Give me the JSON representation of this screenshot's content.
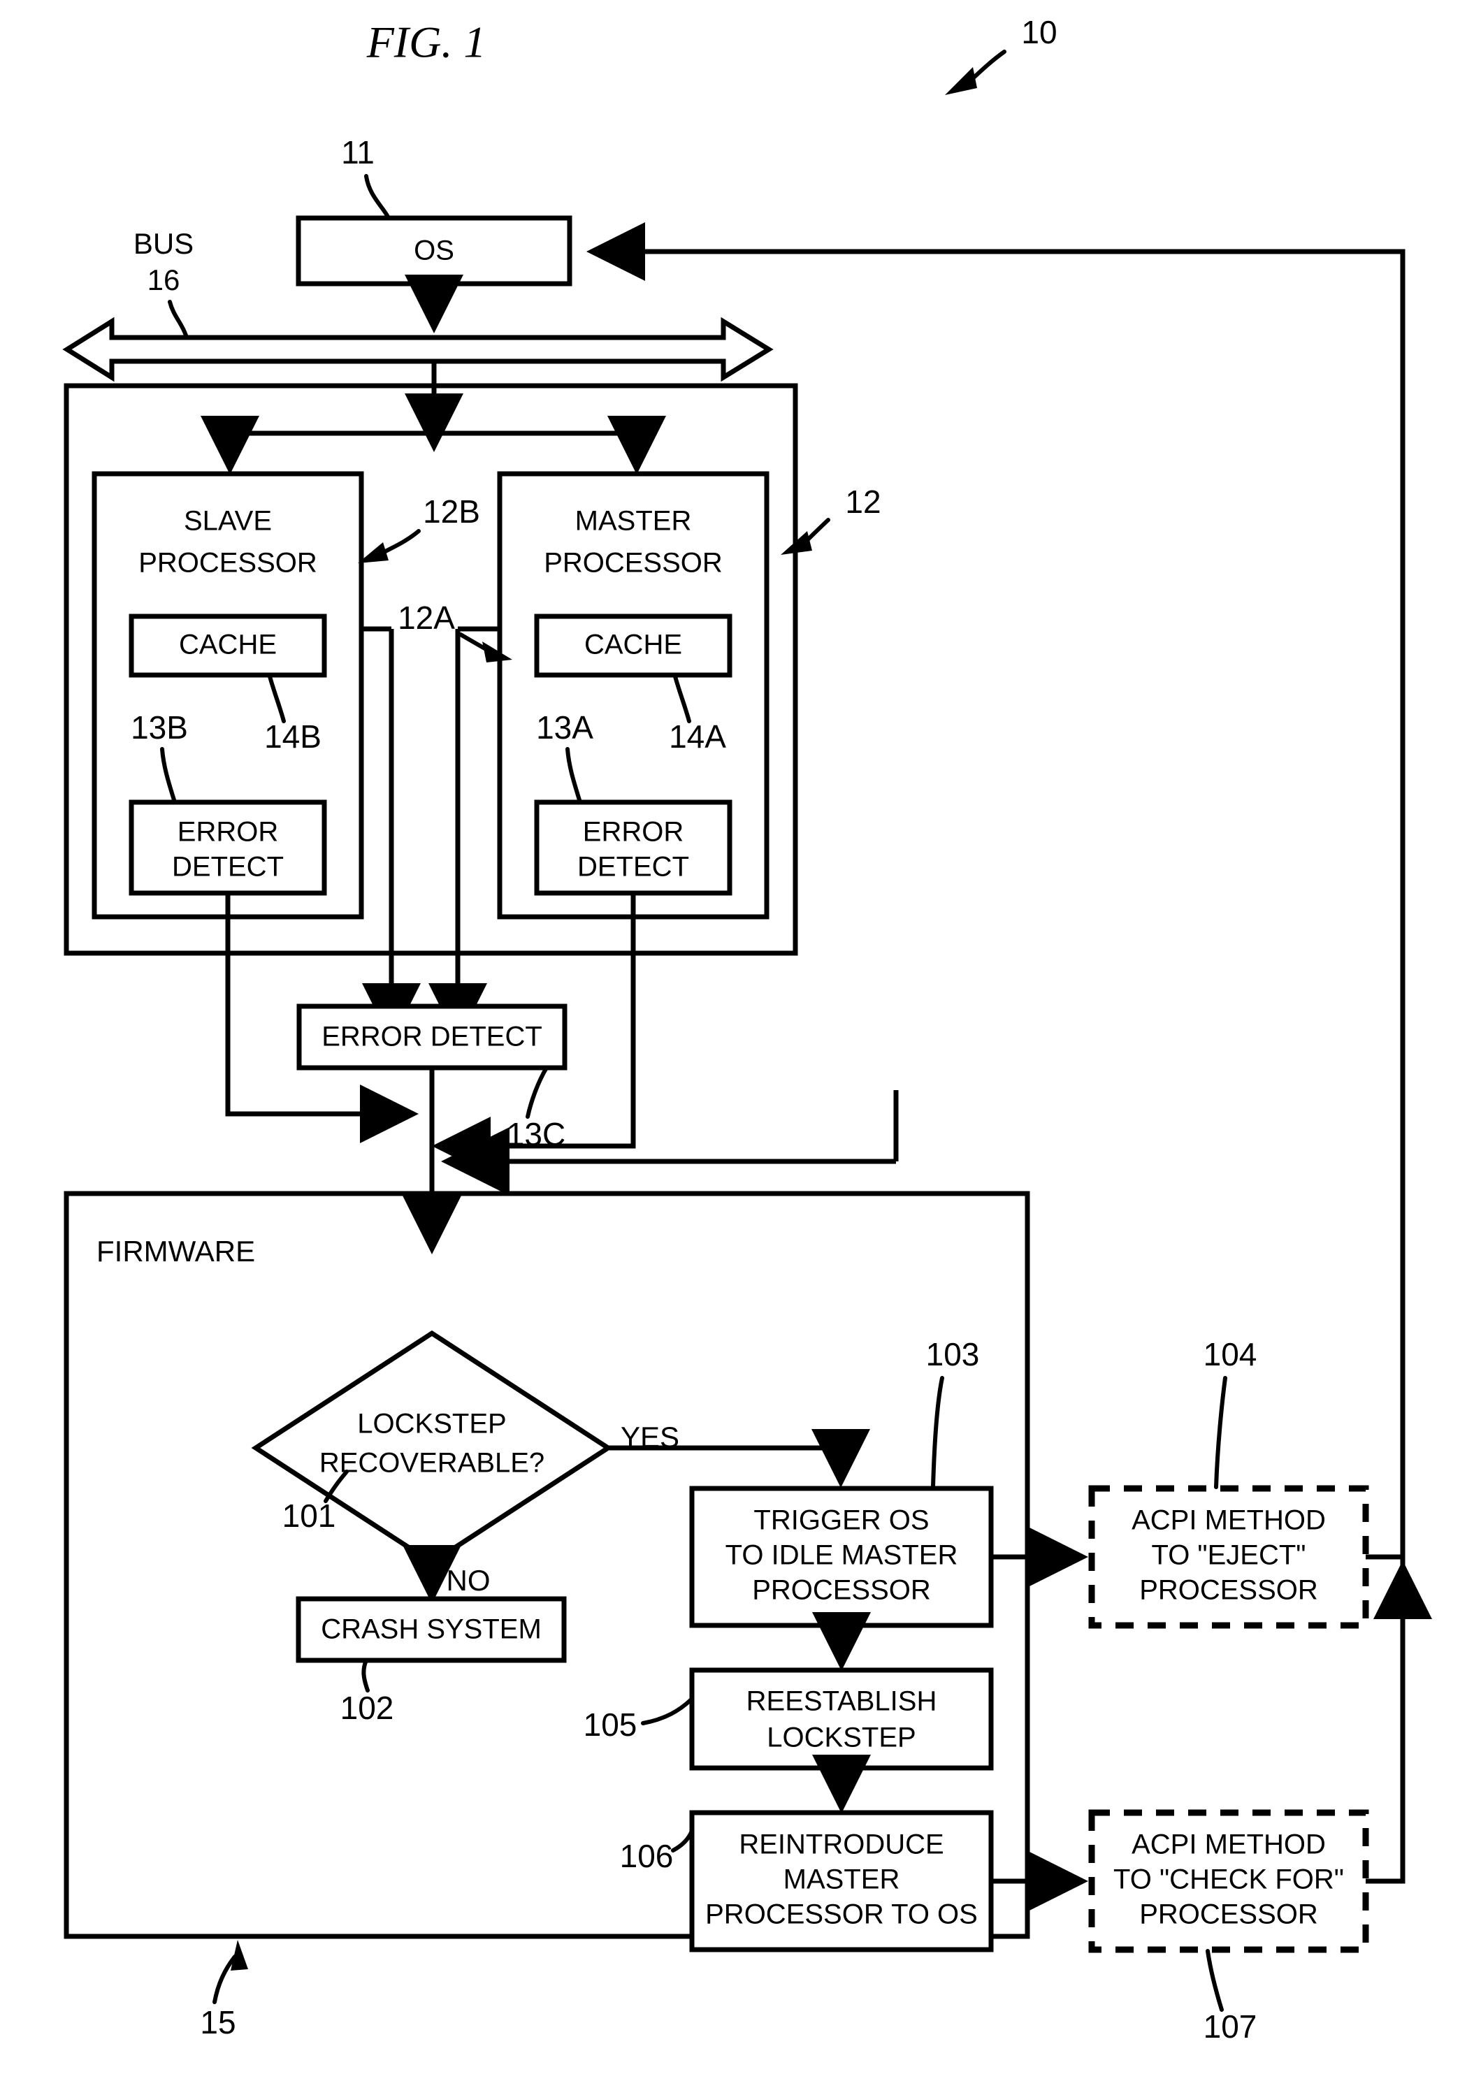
{
  "figure": {
    "title": "FIG. 1",
    "system_ref": "10"
  },
  "nodes": {
    "os": {
      "label": "OS",
      "ref": "11"
    },
    "bus": {
      "label": "BUS",
      "ref": "16"
    },
    "processor_complex": {
      "ref": "12"
    },
    "slave_processor": {
      "line1": "SLAVE",
      "line2": "PROCESSOR",
      "ref": "12B"
    },
    "master_processor": {
      "line1": "MASTER",
      "line2": "PROCESSOR",
      "ref": "12A"
    },
    "slave_cache": {
      "label": "CACHE",
      "ref": "14B"
    },
    "master_cache": {
      "label": "CACHE",
      "ref": "14A"
    },
    "slave_error_detect": {
      "line1": "ERROR",
      "line2": "DETECT",
      "ref": "13B"
    },
    "master_error_detect": {
      "line1": "ERROR",
      "line2": "DETECT",
      "ref": "13A"
    },
    "shared_error_detect": {
      "label": "ERROR DETECT",
      "ref": "13C"
    },
    "firmware": {
      "label": "FIRMWARE",
      "ref": "15"
    },
    "decision": {
      "line1": "LOCKSTEP",
      "line2": "RECOVERABLE?",
      "ref": "101"
    },
    "branch_yes": {
      "label": "YES"
    },
    "branch_no": {
      "label": "NO"
    },
    "crash_system": {
      "label": "CRASH SYSTEM",
      "ref": "102"
    },
    "trigger_os": {
      "line1": "TRIGGER OS",
      "line2": "TO IDLE MASTER",
      "line3": "PROCESSOR",
      "ref": "103"
    },
    "acpi_eject": {
      "line1": "ACPI METHOD",
      "line2": "TO \"EJECT\"",
      "line3": "PROCESSOR",
      "ref": "104"
    },
    "reestablish_lockstep": {
      "line1": "REESTABLISH",
      "line2": "LOCKSTEP",
      "ref": "105"
    },
    "reintroduce_master": {
      "line1": "REINTRODUCE",
      "line2": "MASTER",
      "line3": "PROCESSOR TO OS",
      "ref": "106"
    },
    "acpi_check_for": {
      "line1": "ACPI METHOD",
      "line2": "TO \"CHECK FOR\"",
      "line3": "PROCESSOR",
      "ref": "107"
    }
  },
  "colors": {
    "stroke": "#000000",
    "background": "#ffffff"
  }
}
